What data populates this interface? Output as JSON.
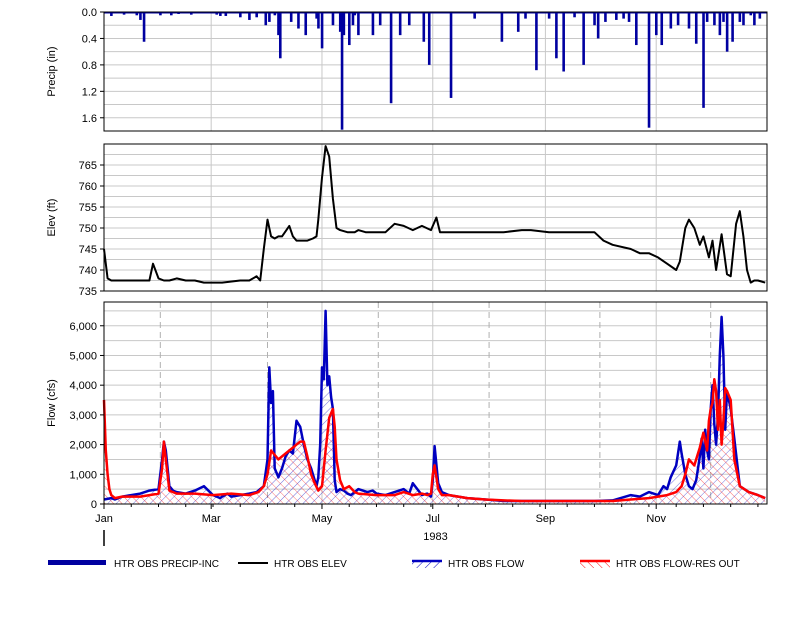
{
  "chart_data": [
    {
      "type": "bar",
      "name": "precip",
      "ylabel": "Precip (in)",
      "ylim": [
        0,
        1.8
      ],
      "inverted": true,
      "yticks": [
        "0.0",
        "0.4",
        "0.8",
        "1.2",
        "1.6"
      ],
      "ytick_values": [
        0,
        0.4,
        0.8,
        1.2,
        1.6
      ],
      "color": "#0000a0",
      "series": [
        {
          "name": "HTR OBS PRECIP-INC",
          "x_day": [
            4,
            11,
            18,
            20,
            22,
            31,
            37,
            41,
            48,
            62,
            64,
            67,
            72,
            74,
            75,
            80,
            84,
            89,
            91,
            94,
            96,
            97,
            103,
            107,
            111,
            117,
            118,
            120,
            126,
            130,
            131,
            132,
            135,
            137,
            138,
            140,
            148,
            152,
            158,
            163,
            168,
            176,
            179,
            191,
            204,
            219,
            228,
            232,
            238,
            245,
            249,
            253,
            259,
            264,
            270,
            272,
            276,
            282,
            286,
            289,
            293,
            300,
            304,
            307,
            312,
            316,
            322,
            326,
            330,
            332,
            336,
            339,
            341,
            343,
            346,
            350,
            352,
            356,
            358,
            361
          ],
          "values": [
            0.06,
            0.04,
            0.05,
            0.12,
            0.45,
            0.05,
            0.05,
            0.03,
            0.04,
            0.04,
            0.06,
            0.06,
            0.02,
            0.02,
            0.08,
            0.12,
            0.08,
            0.2,
            0.15,
            0.05,
            0.35,
            0.7,
            0.15,
            0.25,
            0.35,
            0.1,
            0.25,
            0.55,
            0.2,
            0.3,
            1.78,
            0.35,
            0.5,
            0.2,
            0.05,
            0.35,
            0.35,
            0.2,
            1.38,
            0.35,
            0.2,
            0.45,
            0.8,
            1.3,
            0.1,
            0.45,
            0.3,
            0.1,
            0.88,
            0.1,
            0.7,
            0.9,
            0.08,
            0.8,
            0.2,
            0.4,
            0.15,
            0.12,
            0.1,
            0.15,
            0.5,
            1.75,
            0.35,
            0.5,
            0.25,
            0.2,
            0.25,
            0.48,
            1.45,
            0.15,
            0.2,
            0.35,
            0.15,
            0.6,
            0.45,
            0.15,
            0.2,
            0.05,
            0.2,
            0.1
          ]
        }
      ]
    },
    {
      "type": "line",
      "name": "elev",
      "ylabel": "Elev (ft)",
      "ylim": [
        735,
        770
      ],
      "yticks": [
        "735",
        "740",
        "745",
        "750",
        "755",
        "760",
        "765"
      ],
      "ytick_values": [
        735,
        740,
        745,
        750,
        755,
        760,
        765
      ],
      "series": [
        {
          "name": "HTR OBS ELEV",
          "color": "#000000",
          "x_day": [
            0,
            2,
            4,
            10,
            20,
            25,
            27,
            30,
            33,
            36,
            40,
            45,
            50,
            55,
            65,
            75,
            80,
            84,
            86,
            88,
            90,
            92,
            94,
            96,
            98,
            102,
            104,
            106,
            110,
            112,
            115,
            117,
            118,
            120,
            122,
            124,
            126,
            128,
            130,
            134,
            138,
            140,
            144,
            150,
            155,
            160,
            165,
            170,
            175,
            180,
            183,
            185,
            190,
            200,
            210,
            220,
            230,
            235,
            245,
            260,
            270,
            275,
            280,
            290,
            295,
            300,
            305,
            310,
            315,
            317,
            320,
            322,
            325,
            328,
            330,
            333,
            335,
            337,
            340,
            343,
            345,
            348,
            350,
            352,
            354,
            356,
            358,
            360,
            364
          ],
          "values": [
            745,
            738,
            737.5,
            737.5,
            737.5,
            737.5,
            741.5,
            738,
            737.5,
            737.5,
            738,
            737.5,
            737.5,
            737,
            737,
            737.5,
            737.5,
            738.5,
            737.5,
            745,
            752,
            748,
            747.5,
            748,
            748,
            750.5,
            748,
            747,
            747,
            747,
            747.5,
            748,
            752,
            762,
            769.5,
            767,
            757,
            750,
            749.5,
            749,
            749,
            749.5,
            749,
            749,
            749,
            751,
            750.5,
            749.5,
            750.5,
            749.5,
            752.5,
            749,
            749,
            749,
            749,
            749,
            749.5,
            749.5,
            749,
            749,
            749,
            747,
            746,
            745,
            744,
            744,
            743,
            741.5,
            740,
            742,
            750,
            752,
            750,
            746,
            748,
            743,
            747,
            740,
            748.5,
            739,
            738.5,
            751,
            754,
            748,
            740,
            737,
            737.5,
            737.5,
            737
          ]
        }
      ]
    },
    {
      "type": "area",
      "name": "flow",
      "ylabel": "Flow (cfs)",
      "ylim": [
        0,
        6800
      ],
      "yticks": [
        "0",
        "1,000",
        "2,000",
        "3,000",
        "4,000",
        "5,000",
        "6,000"
      ],
      "ytick_values": [
        0,
        1000,
        2000,
        3000,
        4000,
        5000,
        6000
      ],
      "xticks": [
        "Jan",
        "Mar",
        "May",
        "Jul",
        "Sep",
        "Nov"
      ],
      "xtick_days": [
        0,
        59,
        120,
        181,
        243,
        304
      ],
      "x_minor_days": [
        31,
        90,
        151,
        212,
        273,
        334
      ],
      "xlabel": "1983",
      "series": [
        {
          "name": "HTR OBS FLOW",
          "color": "#0000c0",
          "x_day": [
            0,
            4,
            6,
            10,
            15,
            20,
            25,
            30,
            32,
            33,
            34,
            36,
            38,
            40,
            45,
            50,
            55,
            60,
            64,
            65,
            68,
            70,
            75,
            80,
            84,
            86,
            88,
            90,
            91,
            92,
            93,
            94,
            96,
            98,
            100,
            102,
            104,
            106,
            108,
            110,
            112,
            114,
            116,
            117,
            118,
            119,
            120,
            121,
            122,
            123,
            124,
            125,
            126,
            127,
            128,
            130,
            132,
            134,
            136,
            138,
            140,
            145,
            148,
            150,
            155,
            160,
            165,
            168,
            170,
            175,
            178,
            180,
            181,
            182,
            184,
            186,
            190,
            200,
            210,
            220,
            230,
            240,
            250,
            260,
            270,
            280,
            290,
            295,
            300,
            305,
            308,
            310,
            312,
            315,
            317,
            318,
            320,
            322,
            324,
            326,
            327,
            328,
            329,
            330,
            331,
            332,
            333,
            334,
            335,
            336,
            337,
            338,
            339,
            340,
            341,
            342,
            343,
            345,
            347,
            350,
            355,
            360,
            364
          ],
          "values": [
            150,
            200,
            150,
            250,
            300,
            350,
            450,
            500,
            1500,
            2100,
            1800,
            600,
            450,
            400,
            350,
            450,
            600,
            300,
            200,
            250,
            350,
            250,
            300,
            350,
            400,
            500,
            600,
            1500,
            4600,
            3400,
            3800,
            1200,
            900,
            1200,
            1600,
            1800,
            1700,
            2800,
            2600,
            2000,
            1500,
            1200,
            800,
            600,
            900,
            2000,
            4600,
            4200,
            6500,
            4000,
            4300,
            3600,
            3200,
            800,
            400,
            500,
            450,
            350,
            300,
            400,
            500,
            400,
            450,
            350,
            300,
            400,
            500,
            350,
            700,
            300,
            350,
            250,
            800,
            1950,
            700,
            400,
            300,
            200,
            150,
            100,
            100,
            100,
            100,
            100,
            100,
            120,
            300,
            250,
            400,
            300,
            600,
            500,
            900,
            1300,
            2100,
            1700,
            1000,
            600,
            500,
            800,
            1200,
            1600,
            2200,
            1200,
            2500,
            1800,
            1500,
            3200,
            4000,
            2700,
            2000,
            3000,
            5000,
            6300,
            5000,
            2500,
            3800,
            3200,
            2200,
            600,
            400,
            300,
            200
          ]
        },
        {
          "name": "HTR OBS FLOW-RES OUT",
          "color": "#ff0000",
          "x_day": [
            0,
            1,
            2,
            3,
            4,
            6,
            10,
            20,
            30,
            32,
            33,
            34,
            36,
            40,
            50,
            60,
            70,
            80,
            85,
            88,
            90,
            92,
            96,
            100,
            104,
            106,
            108,
            110,
            112,
            114,
            116,
            118,
            120,
            122,
            124,
            126,
            127,
            128,
            130,
            132,
            135,
            138,
            140,
            150,
            160,
            165,
            170,
            175,
            178,
            180,
            181,
            182,
            184,
            186,
            190,
            200,
            210,
            220,
            230,
            240,
            250,
            260,
            270,
            280,
            290,
            300,
            305,
            310,
            315,
            318,
            320,
            322,
            325,
            328,
            330,
            332,
            333,
            334,
            335,
            336,
            337,
            338,
            339,
            340,
            341,
            342,
            343,
            345,
            347,
            350,
            355,
            360,
            364
          ],
          "values": [
            3500,
            1800,
            1000,
            500,
            300,
            200,
            250,
            250,
            350,
            1200,
            2100,
            1500,
            450,
            350,
            350,
            300,
            350,
            300,
            400,
            600,
            1000,
            1800,
            1500,
            1700,
            1900,
            2000,
            2100,
            2100,
            1600,
            1000,
            700,
            450,
            600,
            1800,
            2900,
            3200,
            2600,
            1500,
            800,
            500,
            600,
            400,
            350,
            300,
            300,
            400,
            300,
            350,
            300,
            350,
            1000,
            1300,
            500,
            300,
            300,
            200,
            150,
            120,
            100,
            100,
            100,
            100,
            100,
            100,
            150,
            200,
            250,
            300,
            400,
            600,
            1000,
            1500,
            1300,
            1900,
            2400,
            1800,
            2800,
            3200,
            3400,
            4200,
            3800,
            2500,
            3500,
            2000,
            2800,
            3900,
            3800,
            3500,
            1500,
            600,
            400,
            300,
            200
          ]
        }
      ]
    }
  ],
  "legend": {
    "items": [
      {
        "label": "HTR OBS PRECIP-INC",
        "color": "#0000a0",
        "style": "thick"
      },
      {
        "label": "HTR OBS ELEV",
        "color": "#000000",
        "style": "line"
      },
      {
        "label": "HTR OBS FLOW",
        "color": "#0000c0",
        "style": "hatch"
      },
      {
        "label": "HTR OBS FLOW-RES OUT",
        "color": "#ff0000",
        "style": "hatch"
      }
    ]
  }
}
